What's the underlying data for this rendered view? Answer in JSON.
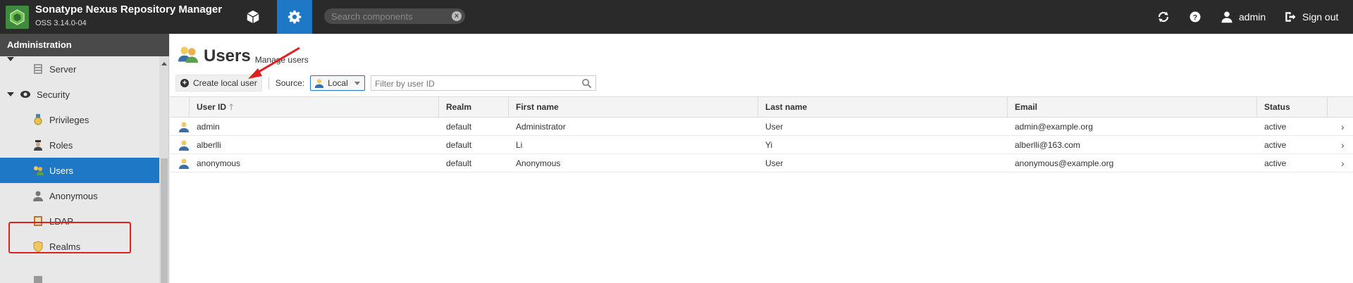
{
  "header": {
    "app_title": "Sonatype Nexus Repository Manager",
    "app_version": "OSS 3.14.0-04",
    "search_placeholder": "Search components",
    "user_name": "admin",
    "signout_label": "Sign out"
  },
  "sidebar": {
    "title": "Administration",
    "items": [
      {
        "label": "Server",
        "icon": "server-icon",
        "level": 2
      },
      {
        "label": "Security",
        "icon": "security-icon",
        "level": 1
      },
      {
        "label": "Privileges",
        "icon": "medal-icon",
        "level": 2
      },
      {
        "label": "Roles",
        "icon": "roles-icon",
        "level": 2
      },
      {
        "label": "Users",
        "icon": "users-icon",
        "level": 2,
        "active": true
      },
      {
        "label": "Anonymous",
        "icon": "person-icon",
        "level": 2
      },
      {
        "label": "LDAP",
        "icon": "book-icon",
        "level": 2
      },
      {
        "label": "Realms",
        "icon": "shield-icon",
        "level": 2
      }
    ]
  },
  "main": {
    "title": "Users",
    "subtitle": "Manage users",
    "toolbar": {
      "create_label": "Create local user",
      "source_label": "Source:",
      "source_value": "Local",
      "filter_placeholder": "Filter by user ID"
    },
    "grid": {
      "columns": [
        "User ID",
        "Realm",
        "First name",
        "Last name",
        "Email",
        "Status"
      ],
      "rows": [
        {
          "user_id": "admin",
          "realm": "default",
          "first_name": "Administrator",
          "last_name": "User",
          "email": "admin@example.org",
          "status": "active"
        },
        {
          "user_id": "alberlli",
          "realm": "default",
          "first_name": "Li",
          "last_name": "Yi",
          "email": "alberlli@163.com",
          "status": "active"
        },
        {
          "user_id": "anonymous",
          "realm": "default",
          "first_name": "Anonymous",
          "last_name": "User",
          "email": "anonymous@example.org",
          "status": "active"
        }
      ]
    }
  },
  "colors": {
    "header_bg": "#2a2a2a",
    "accent": "#1f78c6",
    "annotation": "#e02020"
  }
}
